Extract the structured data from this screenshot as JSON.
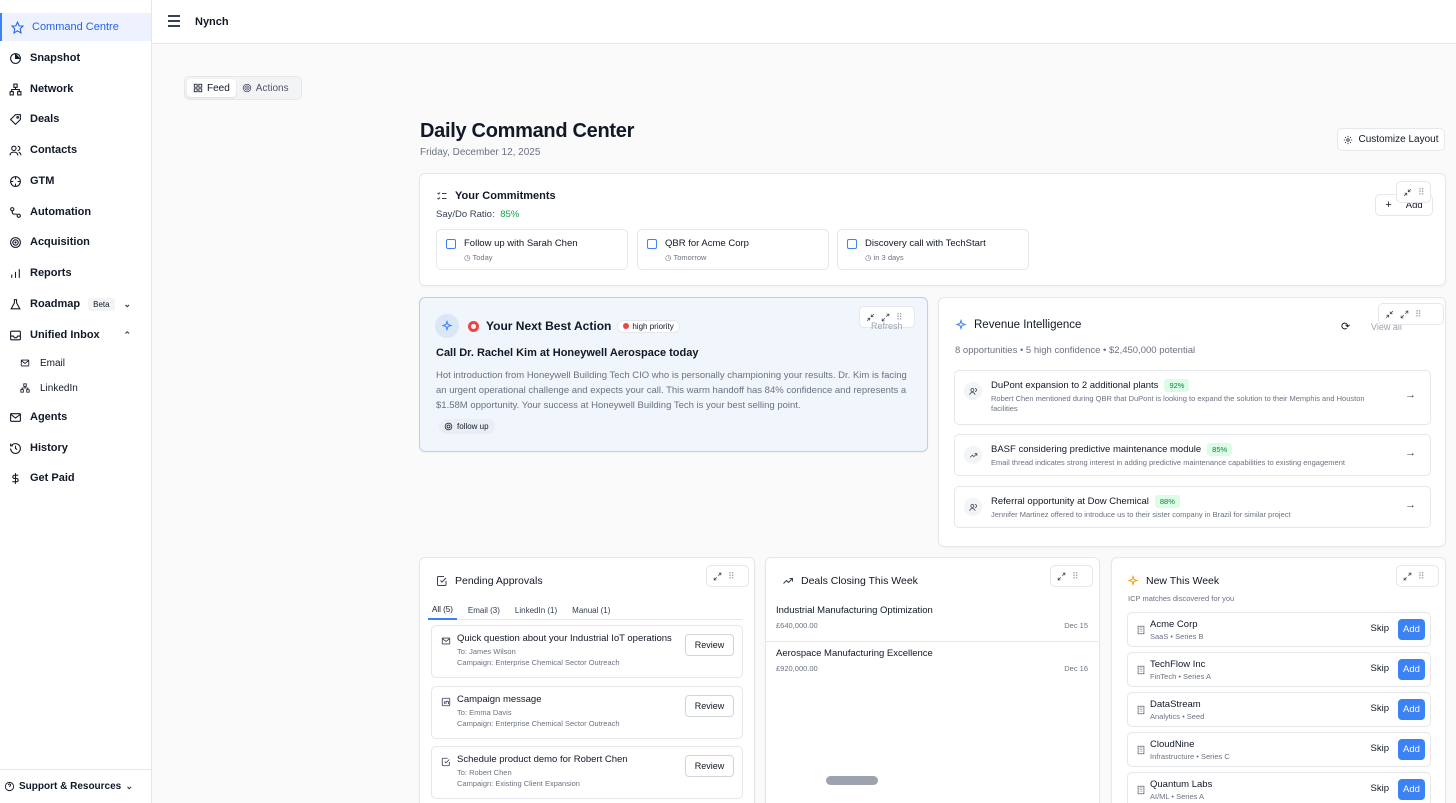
{
  "app_name": "Nynch",
  "sidebar": {
    "items": [
      {
        "label": "Command Centre",
        "icon": "star-icon"
      },
      {
        "label": "Snapshot",
        "icon": "pie-icon"
      },
      {
        "label": "Network",
        "icon": "network-icon"
      },
      {
        "label": "Deals",
        "icon": "tag-icon"
      },
      {
        "label": "Contacts",
        "icon": "users-icon"
      },
      {
        "label": "GTM",
        "icon": "crosshair-icon"
      },
      {
        "label": "Automation",
        "icon": "workflow-icon"
      },
      {
        "label": "Acquisition",
        "icon": "target-icon"
      },
      {
        "label": "Reports",
        "icon": "bar-chart-icon"
      },
      {
        "label": "Roadmap",
        "badge": "Beta",
        "icon": "flask-icon"
      },
      {
        "label": "Unified Inbox",
        "icon": "inbox-icon"
      },
      {
        "label": "Email",
        "icon": "mail-icon"
      },
      {
        "label": "LinkedIn",
        "icon": "network-icon"
      },
      {
        "label": "Agents",
        "icon": "mail-icon"
      },
      {
        "label": "History",
        "icon": "history-icon"
      },
      {
        "label": "Get Paid",
        "icon": "dollar-icon"
      }
    ],
    "support_label": "Support & Resources"
  },
  "view_toggle": {
    "feed": "Feed",
    "actions": "Actions"
  },
  "header": {
    "title": "Daily Command Center",
    "date": "Friday, December 12, 2025",
    "customize_label": "Customize Layout"
  },
  "commitments": {
    "title": "Your Commitments",
    "ratio_label": "Say/Do Ratio:",
    "ratio_value": "85%",
    "add_label": "Add",
    "items": [
      {
        "text": "Follow up with Sarah Chen",
        "due": "Today"
      },
      {
        "text": "QBR for Acme Corp",
        "due": "Tomorrow"
      },
      {
        "text": "Discovery call with TechStart",
        "due": "in 3 days"
      }
    ]
  },
  "next_best_action": {
    "title": "Your Next Best Action",
    "priority": "high priority",
    "refresh_label": "Refresh",
    "headline": "Call Dr. Rachel Kim at Honeywell Aerospace today",
    "body": "Hot introduction from Honeywell Building Tech CIO who is personally championing your results. Dr. Kim is facing an urgent operational challenge and expects your call. This warm handoff has 84% confidence and represents a $1.58M opportunity. Your success at Honeywell Building Tech is your best selling point.",
    "tag": "follow up"
  },
  "revenue": {
    "title": "Revenue Intelligence",
    "view_all": "View all",
    "summary": "8 opportunities • 5 high confidence • $2,450,000 potential",
    "items": [
      {
        "title": "DuPont expansion to 2 additional plants",
        "pct": "92%",
        "desc": "Robert Chen mentioned during QBR that DuPont is looking to expand the solution to their Memphis and Houston facilities"
      },
      {
        "title": "BASF considering predictive maintenance module",
        "pct": "85%",
        "desc": "Email thread indicates strong interest in adding predictive maintenance capabilities to existing engagement"
      },
      {
        "title": "Referral opportunity at Dow Chemical",
        "pct": "88%",
        "desc": "Jennifer Martinez offered to introduce us to their sister company in Brazil for similar project"
      }
    ]
  },
  "approvals": {
    "title": "Pending Approvals",
    "tabs": [
      "All (5)",
      "Email (3)",
      "LinkedIn (1)",
      "Manual (1)"
    ],
    "review_label": "Review",
    "items": [
      {
        "title": "Quick question about your Industrial IoT operations",
        "to": "To: James Wilson",
        "campaign": "Campaign: Enterprise Chemical Sector Outreach"
      },
      {
        "title": "Campaign message",
        "to": "To: Emma Davis",
        "campaign": "Campaign: Enterprise Chemical Sector Outreach"
      },
      {
        "title": "Schedule product demo for Robert Chen",
        "to": "To: Robert Chen",
        "campaign": "Campaign: Existing Client Expansion"
      }
    ]
  },
  "deals": {
    "title": "Deals Closing This Week",
    "items": [
      {
        "name": "Industrial Manufacturing Optimization",
        "value": "£640,000.00",
        "date": "Dec 15"
      },
      {
        "name": "Aerospace Manufacturing Excellence",
        "value": "£920,000.00",
        "date": "Dec 16"
      }
    ]
  },
  "new_this_week": {
    "title": "New This Week",
    "subtitle": "ICP matches discovered for you",
    "skip_label": "Skip",
    "add_label": "Add",
    "items": [
      {
        "name": "Acme Corp",
        "meta": "SaaS • Series B"
      },
      {
        "name": "TechFlow Inc",
        "meta": "FinTech • Series A"
      },
      {
        "name": "DataStream",
        "meta": "Analytics • Seed"
      },
      {
        "name": "CloudNine",
        "meta": "Infrastructure • Series C"
      },
      {
        "name": "Quantum Labs",
        "meta": "AI/ML • Series A"
      }
    ]
  },
  "colors": {
    "accent": "#3b82f6",
    "success": "#16a34a",
    "priority": "#ef4444"
  }
}
